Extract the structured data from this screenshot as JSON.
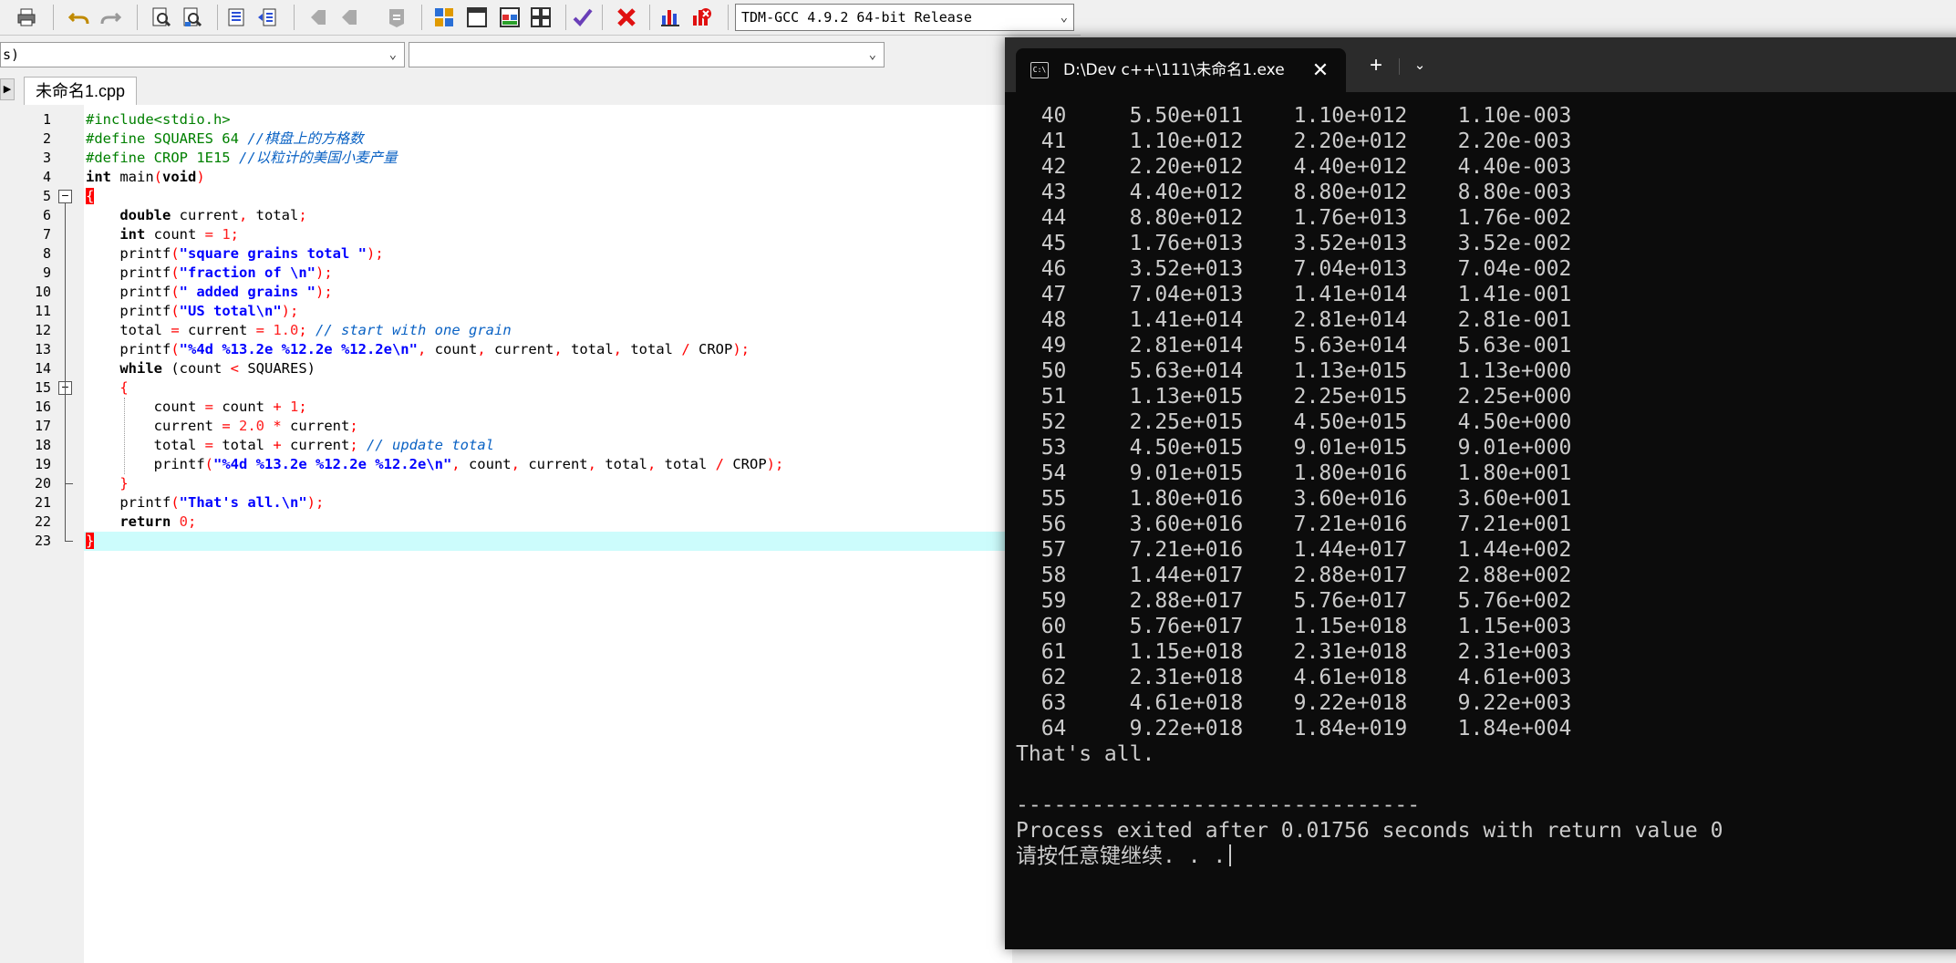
{
  "toolbar": {
    "buttons": [
      {
        "name": "print-icon"
      },
      {
        "name": "undo-icon"
      },
      {
        "name": "redo-icon"
      },
      {
        "name": "find-icon"
      },
      {
        "name": "replace-icon"
      },
      {
        "name": "indent-icon"
      },
      {
        "name": "unindent-icon"
      },
      {
        "name": "goto-back-icon"
      },
      {
        "name": "goto-forward-icon"
      },
      {
        "name": "bookmark-icon"
      },
      {
        "name": "compile-icon"
      },
      {
        "name": "run-icon"
      },
      {
        "name": "compile-run-icon"
      },
      {
        "name": "rebuild-icon"
      },
      {
        "name": "syntax-check-icon"
      },
      {
        "name": "stop-icon"
      },
      {
        "name": "profile-icon"
      },
      {
        "name": "delete-profile-icon"
      }
    ],
    "compiler": "TDM-GCC 4.9.2 64-bit Release"
  },
  "classbar": {
    "class_value": "s)",
    "member_value": ""
  },
  "editor": {
    "tab_label": "未命名1.cpp",
    "lines": [
      {
        "n": "1"
      },
      {
        "n": "2"
      },
      {
        "n": "3"
      },
      {
        "n": "4"
      },
      {
        "n": "5"
      },
      {
        "n": "6"
      },
      {
        "n": "7"
      },
      {
        "n": "8"
      },
      {
        "n": "9"
      },
      {
        "n": "10"
      },
      {
        "n": "11"
      },
      {
        "n": "12"
      },
      {
        "n": "13"
      },
      {
        "n": "14"
      },
      {
        "n": "15"
      },
      {
        "n": "16"
      },
      {
        "n": "17"
      },
      {
        "n": "18"
      },
      {
        "n": "19"
      },
      {
        "n": "20"
      },
      {
        "n": "21"
      },
      {
        "n": "22"
      },
      {
        "n": "23"
      }
    ],
    "code": {
      "l1_pp": "#include<stdio.h>",
      "l2_pp": "#define SQUARES 64 ",
      "l2_cm": "//棋盘上的方格数",
      "l3_pp": "#define CROP 1E15 ",
      "l3_cm": "//以粒计的美国小麦产量",
      "l4_kw": "int",
      "l4_rest": " main",
      "l4_open": "(",
      "l4_kw2": "void",
      "l4_close": ")",
      "l5_brace": "{",
      "l6_kw": "double",
      "l6_rest": " current",
      "l6_comma": ",",
      "l6_rest2": " total",
      "l6_semi": ";",
      "l7_kw": "int",
      "l7_rest": " count ",
      "l7_eq": "=",
      "l7_num": " 1",
      "l7_semi": ";",
      "l8_fn": "printf",
      "l8_str": "\"square grains total \"",
      "l9_fn": "printf",
      "l9_str": "\"fraction of \\n\"",
      "l10_fn": "printf",
      "l10_str": "\" added grains \"",
      "l11_fn": "printf",
      "l11_str": "\"US total\\n\"",
      "l12_rest": "total ",
      "l12_eq": "=",
      "l12_rest2": " current ",
      "l12_eq2": "=",
      "l12_num": " 1.0",
      "l12_semi": "; ",
      "l12_cm": "// start with one grain",
      "l13_fn": "printf",
      "l13_str": "\"%4d %13.2e %12.2e %12.2e\\n\"",
      "l13_args": " count",
      "l13_args2": " current",
      "l13_args3": " total",
      "l13_args4": " total ",
      "l13_div": "/",
      "l13_args5": " CROP",
      "l14_kw": "while",
      "l14_rest": " (count ",
      "l14_lt": "<",
      "l14_rest2": " SQUARES)",
      "l15_brace": "{",
      "l16_rest": "count ",
      "l16_eq": "=",
      "l16_rest2": " count ",
      "l16_plus": "+",
      "l16_num": " 1",
      "l16_semi": ";",
      "l17_rest": "current ",
      "l17_eq": "=",
      "l17_num": " 2.0",
      "l17_mul": " *",
      "l17_rest2": " current",
      "l17_semi": ";",
      "l18_rest": "total ",
      "l18_eq": "=",
      "l18_rest2": " total ",
      "l18_plus": "+",
      "l18_rest3": " current",
      "l18_semi": "; ",
      "l18_cm": "// update total",
      "l19_fn": "printf",
      "l19_str": "\"%4d %13.2e %12.2e %12.2e\\n\"",
      "l20_brace": "}",
      "l21_fn": "printf",
      "l21_str": "\"That's all.\\n\"",
      "l22_kw": "return",
      "l22_num": " 0",
      "l22_semi": ";",
      "l23_brace": "}"
    }
  },
  "console": {
    "title": "D:\\Dev c++\\111\\未命名1.exe",
    "icon_text": "C:\\",
    "close_glyph": "✕",
    "new_tab_glyph": "+",
    "dropdown_glyph": "⌄",
    "rows": [
      [
        "40",
        "5.50e+011",
        "1.10e+012",
        "1.10e-003"
      ],
      [
        "41",
        "1.10e+012",
        "2.20e+012",
        "2.20e-003"
      ],
      [
        "42",
        "2.20e+012",
        "4.40e+012",
        "4.40e-003"
      ],
      [
        "43",
        "4.40e+012",
        "8.80e+012",
        "8.80e-003"
      ],
      [
        "44",
        "8.80e+012",
        "1.76e+013",
        "1.76e-002"
      ],
      [
        "45",
        "1.76e+013",
        "3.52e+013",
        "3.52e-002"
      ],
      [
        "46",
        "3.52e+013",
        "7.04e+013",
        "7.04e-002"
      ],
      [
        "47",
        "7.04e+013",
        "1.41e+014",
        "1.41e-001"
      ],
      [
        "48",
        "1.41e+014",
        "2.81e+014",
        "2.81e-001"
      ],
      [
        "49",
        "2.81e+014",
        "5.63e+014",
        "5.63e-001"
      ],
      [
        "50",
        "5.63e+014",
        "1.13e+015",
        "1.13e+000"
      ],
      [
        "51",
        "1.13e+015",
        "2.25e+015",
        "2.25e+000"
      ],
      [
        "52",
        "2.25e+015",
        "4.50e+015",
        "4.50e+000"
      ],
      [
        "53",
        "4.50e+015",
        "9.01e+015",
        "9.01e+000"
      ],
      [
        "54",
        "9.01e+015",
        "1.80e+016",
        "1.80e+001"
      ],
      [
        "55",
        "1.80e+016",
        "3.60e+016",
        "3.60e+001"
      ],
      [
        "56",
        "3.60e+016",
        "7.21e+016",
        "7.21e+001"
      ],
      [
        "57",
        "7.21e+016",
        "1.44e+017",
        "1.44e+002"
      ],
      [
        "58",
        "1.44e+017",
        "2.88e+017",
        "2.88e+002"
      ],
      [
        "59",
        "2.88e+017",
        "5.76e+017",
        "5.76e+002"
      ],
      [
        "60",
        "5.76e+017",
        "1.15e+018",
        "1.15e+003"
      ],
      [
        "61",
        "1.15e+018",
        "2.31e+018",
        "2.31e+003"
      ],
      [
        "62",
        "2.31e+018",
        "4.61e+018",
        "4.61e+003"
      ],
      [
        "63",
        "4.61e+018",
        "9.22e+018",
        "9.22e+003"
      ],
      [
        "64",
        "9.22e+018",
        "1.84e+019",
        "1.84e+004"
      ]
    ],
    "done_line": "That's all.",
    "separator": "--------------------------------",
    "exit_line": "Process exited after 0.01756 seconds with return value 0",
    "prompt_line": "请按任意键继续. . ."
  }
}
